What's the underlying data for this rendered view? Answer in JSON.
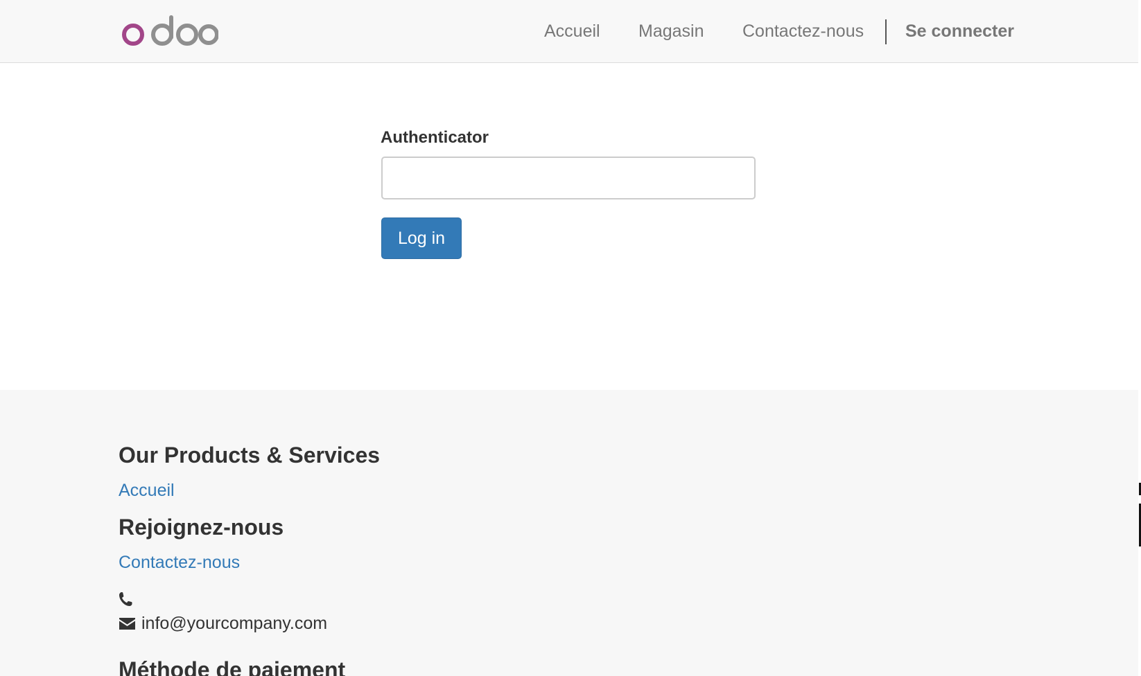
{
  "header": {
    "logo_text": "odoo",
    "nav": {
      "home": "Accueil",
      "shop": "Magasin",
      "contact": "Contactez-nous",
      "login": "Se connecter"
    }
  },
  "main": {
    "auth_label": "Authenticator",
    "auth_value": "",
    "login_button": "Log in"
  },
  "footer": {
    "products_title": "Our Products & Services",
    "products_link_home": "Accueil",
    "join_title": "Rejoignez-nous",
    "join_link_contact": "Contactez-nous",
    "email": "info@yourcompany.com",
    "payment_title": "Méthode de paiement"
  },
  "colors": {
    "header_bg": "#f8f8f8",
    "footer_bg": "#f7f7f7",
    "primary": "#337ab7",
    "logo_purple": "#a24689",
    "logo_gray": "#8f8f8f"
  },
  "icons": {
    "phone": "phone-icon",
    "mail": "envelope-icon"
  }
}
